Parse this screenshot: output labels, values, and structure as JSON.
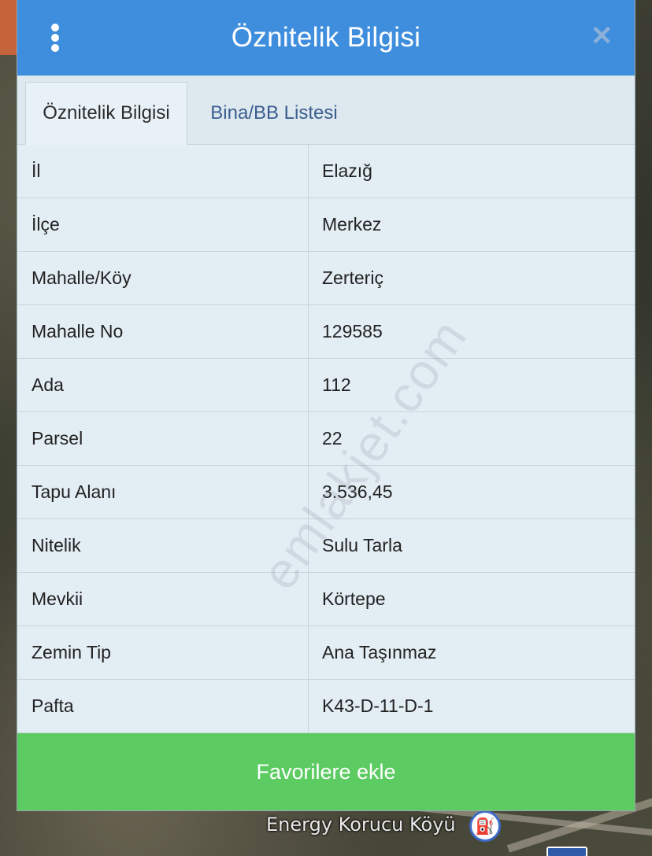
{
  "dialog": {
    "title": "Öznitelik Bilgisi"
  },
  "tabs": [
    {
      "label": "Öznitelik Bilgisi",
      "active": true
    },
    {
      "label": "Bina/BB Listesi",
      "active": false
    }
  ],
  "attributes": [
    {
      "key": "İl",
      "value": "Elazığ"
    },
    {
      "key": "İlçe",
      "value": "Merkez"
    },
    {
      "key": "Mahalle/Köy",
      "value": "Zerteriç"
    },
    {
      "key": "Mahalle No",
      "value": "129585"
    },
    {
      "key": "Ada",
      "value": "112"
    },
    {
      "key": "Parsel",
      "value": "22"
    },
    {
      "key": "Tapu Alanı",
      "value": "3.536,45"
    },
    {
      "key": "Nitelik",
      "value": "Sulu Tarla"
    },
    {
      "key": "Mevkii",
      "value": "Körtepe"
    },
    {
      "key": "Zemin Tip",
      "value": "Ana Taşınmaz"
    },
    {
      "key": "Pafta",
      "value": "K43-D-11-D-1"
    }
  ],
  "actions": {
    "favorite_label": "Favorilere ekle"
  },
  "map": {
    "place_label": "Energy Korucu Köyü"
  },
  "watermark": "emlakjet.com",
  "icons": {
    "menu": "kebab-menu-icon",
    "close": "close-icon",
    "poi": "fuel-station-icon"
  },
  "colors": {
    "header": "#3f8ede",
    "button": "#5ccb62",
    "panel": "#e2ecf3"
  }
}
